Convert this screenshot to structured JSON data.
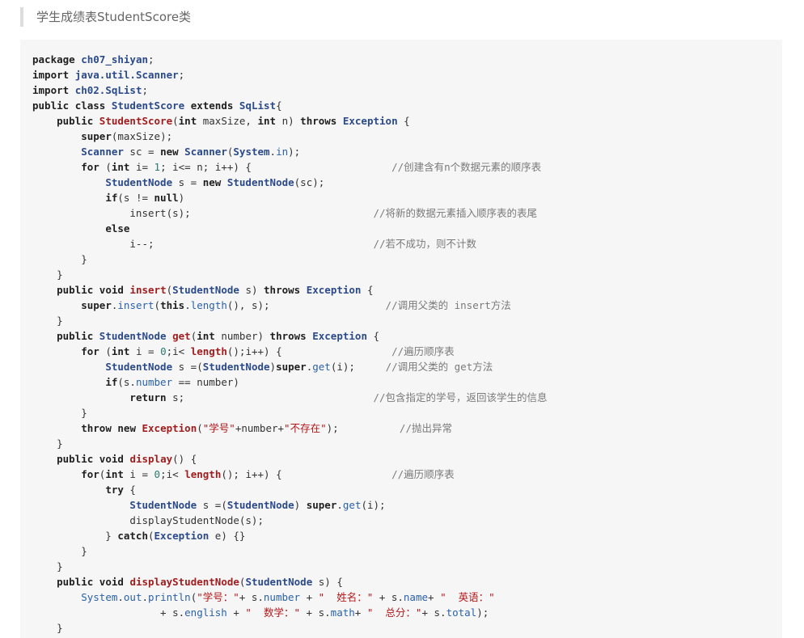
{
  "section": {
    "title": "学生成绩表StudentScore类"
  },
  "colors": {
    "panel_background": "#f6f6f7",
    "heading_border": "#dddddd",
    "keyword": "#1f1f1f",
    "type": "#2b4a8a",
    "function_name": "#a11d1d",
    "string": "#b21818",
    "number": "#2d7a6e",
    "method_call": "#2a61a8",
    "comment": "#7a7a7a"
  },
  "code": {
    "lines": [
      [
        {
          "t": "k",
          "v": "package"
        },
        {
          "t": "p",
          "v": " "
        },
        {
          "t": "y",
          "v": "ch07_shiyan"
        },
        {
          "t": "p",
          "v": ";"
        }
      ],
      [
        {
          "t": "k",
          "v": "import"
        },
        {
          "t": "p",
          "v": " "
        },
        {
          "t": "y",
          "v": "java.util.Scanner"
        },
        {
          "t": "p",
          "v": ";"
        }
      ],
      [
        {
          "t": "k",
          "v": "import"
        },
        {
          "t": "p",
          "v": " "
        },
        {
          "t": "y",
          "v": "ch02.SqList"
        },
        {
          "t": "p",
          "v": ";"
        }
      ],
      [
        {
          "t": "k",
          "v": "public"
        },
        {
          "t": "p",
          "v": " "
        },
        {
          "t": "k",
          "v": "class"
        },
        {
          "t": "p",
          "v": " "
        },
        {
          "t": "y",
          "v": "StudentScore"
        },
        {
          "t": "p",
          "v": " "
        },
        {
          "t": "k",
          "v": "extends"
        },
        {
          "t": "p",
          "v": " "
        },
        {
          "t": "y",
          "v": "SqList"
        },
        {
          "t": "p",
          "v": "{"
        }
      ],
      [
        {
          "t": "p",
          "v": "    "
        },
        {
          "t": "k",
          "v": "public"
        },
        {
          "t": "p",
          "v": " "
        },
        {
          "t": "f",
          "v": "StudentScore"
        },
        {
          "t": "p",
          "v": "("
        },
        {
          "t": "k",
          "v": "int"
        },
        {
          "t": "p",
          "v": " maxSize, "
        },
        {
          "t": "k",
          "v": "int"
        },
        {
          "t": "p",
          "v": " n) "
        },
        {
          "t": "k",
          "v": "throws"
        },
        {
          "t": "p",
          "v": " "
        },
        {
          "t": "y",
          "v": "Exception"
        },
        {
          "t": "p",
          "v": " {"
        }
      ],
      [
        {
          "t": "p",
          "v": "        "
        },
        {
          "t": "k",
          "v": "super"
        },
        {
          "t": "p",
          "v": "(maxSize);"
        }
      ],
      [
        {
          "t": "p",
          "v": "        "
        },
        {
          "t": "y",
          "v": "Scanner"
        },
        {
          "t": "p",
          "v": " sc = "
        },
        {
          "t": "k",
          "v": "new"
        },
        {
          "t": "p",
          "v": " "
        },
        {
          "t": "y",
          "v": "Scanner"
        },
        {
          "t": "p",
          "v": "("
        },
        {
          "t": "y",
          "v": "System"
        },
        {
          "t": "p",
          "v": "."
        },
        {
          "t": "m",
          "v": "in"
        },
        {
          "t": "p",
          "v": ");"
        }
      ],
      [
        {
          "t": "p",
          "v": "        "
        },
        {
          "t": "k",
          "v": "for"
        },
        {
          "t": "p",
          "v": " ("
        },
        {
          "t": "k",
          "v": "int"
        },
        {
          "t": "p",
          "v": " i= "
        },
        {
          "t": "n",
          "v": "1"
        },
        {
          "t": "p",
          "v": "; i<= n; i++) {                       "
        },
        {
          "t": "c",
          "v": "//创建含有n个数据元素的顺序表"
        }
      ],
      [
        {
          "t": "p",
          "v": "            "
        },
        {
          "t": "y",
          "v": "StudentNode"
        },
        {
          "t": "p",
          "v": " s = "
        },
        {
          "t": "k",
          "v": "new"
        },
        {
          "t": "p",
          "v": " "
        },
        {
          "t": "y",
          "v": "StudentNode"
        },
        {
          "t": "p",
          "v": "(sc);"
        }
      ],
      [
        {
          "t": "p",
          "v": "            "
        },
        {
          "t": "k",
          "v": "if"
        },
        {
          "t": "p",
          "v": "(s != "
        },
        {
          "t": "k",
          "v": "null"
        },
        {
          "t": "p",
          "v": ")"
        }
      ],
      [
        {
          "t": "p",
          "v": "                insert(s);                              "
        },
        {
          "t": "c",
          "v": "//将新的数据元素插入顺序表的表尾"
        }
      ],
      [
        {
          "t": "p",
          "v": "            "
        },
        {
          "t": "k",
          "v": "else"
        }
      ],
      [
        {
          "t": "p",
          "v": "                i--;                                    "
        },
        {
          "t": "c",
          "v": "//若不成功，则不计数"
        }
      ],
      [
        {
          "t": "p",
          "v": "        }"
        }
      ],
      [
        {
          "t": "p",
          "v": "    }"
        }
      ],
      [
        {
          "t": "p",
          "v": "    "
        },
        {
          "t": "k",
          "v": "public"
        },
        {
          "t": "p",
          "v": " "
        },
        {
          "t": "k",
          "v": "void"
        },
        {
          "t": "p",
          "v": " "
        },
        {
          "t": "f",
          "v": "insert"
        },
        {
          "t": "p",
          "v": "("
        },
        {
          "t": "y",
          "v": "StudentNode"
        },
        {
          "t": "p",
          "v": " s) "
        },
        {
          "t": "k",
          "v": "throws"
        },
        {
          "t": "p",
          "v": " "
        },
        {
          "t": "y",
          "v": "Exception"
        },
        {
          "t": "p",
          "v": " {"
        }
      ],
      [
        {
          "t": "p",
          "v": "        "
        },
        {
          "t": "k",
          "v": "super"
        },
        {
          "t": "p",
          "v": "."
        },
        {
          "t": "m",
          "v": "insert"
        },
        {
          "t": "p",
          "v": "("
        },
        {
          "t": "k",
          "v": "this"
        },
        {
          "t": "p",
          "v": "."
        },
        {
          "t": "m",
          "v": "length"
        },
        {
          "t": "p",
          "v": "(), s);                   "
        },
        {
          "t": "c",
          "v": "//调用父类的 insert方法"
        }
      ],
      [
        {
          "t": "p",
          "v": "    }"
        }
      ],
      [
        {
          "t": "p",
          "v": "    "
        },
        {
          "t": "k",
          "v": "public"
        },
        {
          "t": "p",
          "v": " "
        },
        {
          "t": "y",
          "v": "StudentNode"
        },
        {
          "t": "p",
          "v": " "
        },
        {
          "t": "f",
          "v": "get"
        },
        {
          "t": "p",
          "v": "("
        },
        {
          "t": "k",
          "v": "int"
        },
        {
          "t": "p",
          "v": " number) "
        },
        {
          "t": "k",
          "v": "throws"
        },
        {
          "t": "p",
          "v": " "
        },
        {
          "t": "y",
          "v": "Exception"
        },
        {
          "t": "p",
          "v": " {"
        }
      ],
      [
        {
          "t": "p",
          "v": "        "
        },
        {
          "t": "k",
          "v": "for"
        },
        {
          "t": "p",
          "v": " ("
        },
        {
          "t": "k",
          "v": "int"
        },
        {
          "t": "p",
          "v": " i = "
        },
        {
          "t": "n",
          "v": "0"
        },
        {
          "t": "p",
          "v": ";i< "
        },
        {
          "t": "f",
          "v": "length"
        },
        {
          "t": "p",
          "v": "();i++) {                  "
        },
        {
          "t": "c",
          "v": "//遍历顺序表"
        }
      ],
      [
        {
          "t": "p",
          "v": "            "
        },
        {
          "t": "y",
          "v": "StudentNode"
        },
        {
          "t": "p",
          "v": " s =("
        },
        {
          "t": "y",
          "v": "StudentNode"
        },
        {
          "t": "p",
          "v": ")"
        },
        {
          "t": "k",
          "v": "super"
        },
        {
          "t": "p",
          "v": "."
        },
        {
          "t": "m",
          "v": "get"
        },
        {
          "t": "p",
          "v": "(i);     "
        },
        {
          "t": "c",
          "v": "//调用父类的 get方法"
        }
      ],
      [
        {
          "t": "p",
          "v": "            "
        },
        {
          "t": "k",
          "v": "if"
        },
        {
          "t": "p",
          "v": "(s."
        },
        {
          "t": "m",
          "v": "number"
        },
        {
          "t": "p",
          "v": " == number)"
        }
      ],
      [
        {
          "t": "p",
          "v": "                "
        },
        {
          "t": "k",
          "v": "return"
        },
        {
          "t": "p",
          "v": " s;                               "
        },
        {
          "t": "c",
          "v": "//包含指定的学号，返回该学生的信息"
        }
      ],
      [
        {
          "t": "p",
          "v": "        }"
        }
      ],
      [
        {
          "t": "p",
          "v": "        "
        },
        {
          "t": "k",
          "v": "throw"
        },
        {
          "t": "p",
          "v": " "
        },
        {
          "t": "k",
          "v": "new"
        },
        {
          "t": "p",
          "v": " "
        },
        {
          "t": "f",
          "v": "Exception"
        },
        {
          "t": "p",
          "v": "("
        },
        {
          "t": "s",
          "v": "\"学号\""
        },
        {
          "t": "p",
          "v": "+number+"
        },
        {
          "t": "s",
          "v": "\"不存在\""
        },
        {
          "t": "p",
          "v": ");          "
        },
        {
          "t": "c",
          "v": "//抛出异常"
        }
      ],
      [
        {
          "t": "p",
          "v": "    }"
        }
      ],
      [
        {
          "t": "p",
          "v": "    "
        },
        {
          "t": "k",
          "v": "public"
        },
        {
          "t": "p",
          "v": " "
        },
        {
          "t": "k",
          "v": "void"
        },
        {
          "t": "p",
          "v": " "
        },
        {
          "t": "f",
          "v": "display"
        },
        {
          "t": "p",
          "v": "() {"
        }
      ],
      [
        {
          "t": "p",
          "v": "        "
        },
        {
          "t": "k",
          "v": "for"
        },
        {
          "t": "p",
          "v": "("
        },
        {
          "t": "k",
          "v": "int"
        },
        {
          "t": "p",
          "v": " i = "
        },
        {
          "t": "n",
          "v": "0"
        },
        {
          "t": "p",
          "v": ";i< "
        },
        {
          "t": "f",
          "v": "length"
        },
        {
          "t": "p",
          "v": "(); i++) {                  "
        },
        {
          "t": "c",
          "v": "//遍历顺序表"
        }
      ],
      [
        {
          "t": "p",
          "v": "            "
        },
        {
          "t": "k",
          "v": "try"
        },
        {
          "t": "p",
          "v": " {"
        }
      ],
      [
        {
          "t": "p",
          "v": "                "
        },
        {
          "t": "y",
          "v": "StudentNode"
        },
        {
          "t": "p",
          "v": " s =("
        },
        {
          "t": "y",
          "v": "StudentNode"
        },
        {
          "t": "p",
          "v": ") "
        },
        {
          "t": "k",
          "v": "super"
        },
        {
          "t": "p",
          "v": "."
        },
        {
          "t": "m",
          "v": "get"
        },
        {
          "t": "p",
          "v": "(i);"
        }
      ],
      [
        {
          "t": "p",
          "v": "                displayStudentNode(s);"
        }
      ],
      [
        {
          "t": "p",
          "v": "            } "
        },
        {
          "t": "k",
          "v": "catch"
        },
        {
          "t": "p",
          "v": "("
        },
        {
          "t": "y",
          "v": "Exception"
        },
        {
          "t": "p",
          "v": " e) {}"
        }
      ],
      [
        {
          "t": "p",
          "v": "        }"
        }
      ],
      [
        {
          "t": "p",
          "v": "    }"
        }
      ],
      [
        {
          "t": "p",
          "v": "    "
        },
        {
          "t": "k",
          "v": "public"
        },
        {
          "t": "p",
          "v": " "
        },
        {
          "t": "k",
          "v": "void"
        },
        {
          "t": "p",
          "v": " "
        },
        {
          "t": "f",
          "v": "displayStudentNode"
        },
        {
          "t": "p",
          "v": "("
        },
        {
          "t": "y",
          "v": "StudentNode"
        },
        {
          "t": "p",
          "v": " s) {"
        }
      ],
      [
        {
          "t": "p",
          "v": "        "
        },
        {
          "t": "m",
          "v": "System"
        },
        {
          "t": "p",
          "v": "."
        },
        {
          "t": "m",
          "v": "out"
        },
        {
          "t": "p",
          "v": "."
        },
        {
          "t": "m",
          "v": "println"
        },
        {
          "t": "p",
          "v": "("
        },
        {
          "t": "s",
          "v": "\"学号：\""
        },
        {
          "t": "p",
          "v": "+ s."
        },
        {
          "t": "m",
          "v": "number"
        },
        {
          "t": "p",
          "v": " + "
        },
        {
          "t": "s",
          "v": "\"  姓名：\""
        },
        {
          "t": "p",
          "v": " + s."
        },
        {
          "t": "m",
          "v": "name"
        },
        {
          "t": "p",
          "v": "+ "
        },
        {
          "t": "s",
          "v": "\"  英语：\""
        }
      ],
      [
        {
          "t": "p",
          "v": "                     + s."
        },
        {
          "t": "m",
          "v": "english"
        },
        {
          "t": "p",
          "v": " + "
        },
        {
          "t": "s",
          "v": "\"  数学：\""
        },
        {
          "t": "p",
          "v": " + s."
        },
        {
          "t": "m",
          "v": "math"
        },
        {
          "t": "p",
          "v": "+ "
        },
        {
          "t": "s",
          "v": "\"  总分：\""
        },
        {
          "t": "p",
          "v": "+ s."
        },
        {
          "t": "m",
          "v": "total"
        },
        {
          "t": "p",
          "v": ");"
        }
      ],
      [
        {
          "t": "p",
          "v": "    }"
        }
      ]
    ]
  }
}
